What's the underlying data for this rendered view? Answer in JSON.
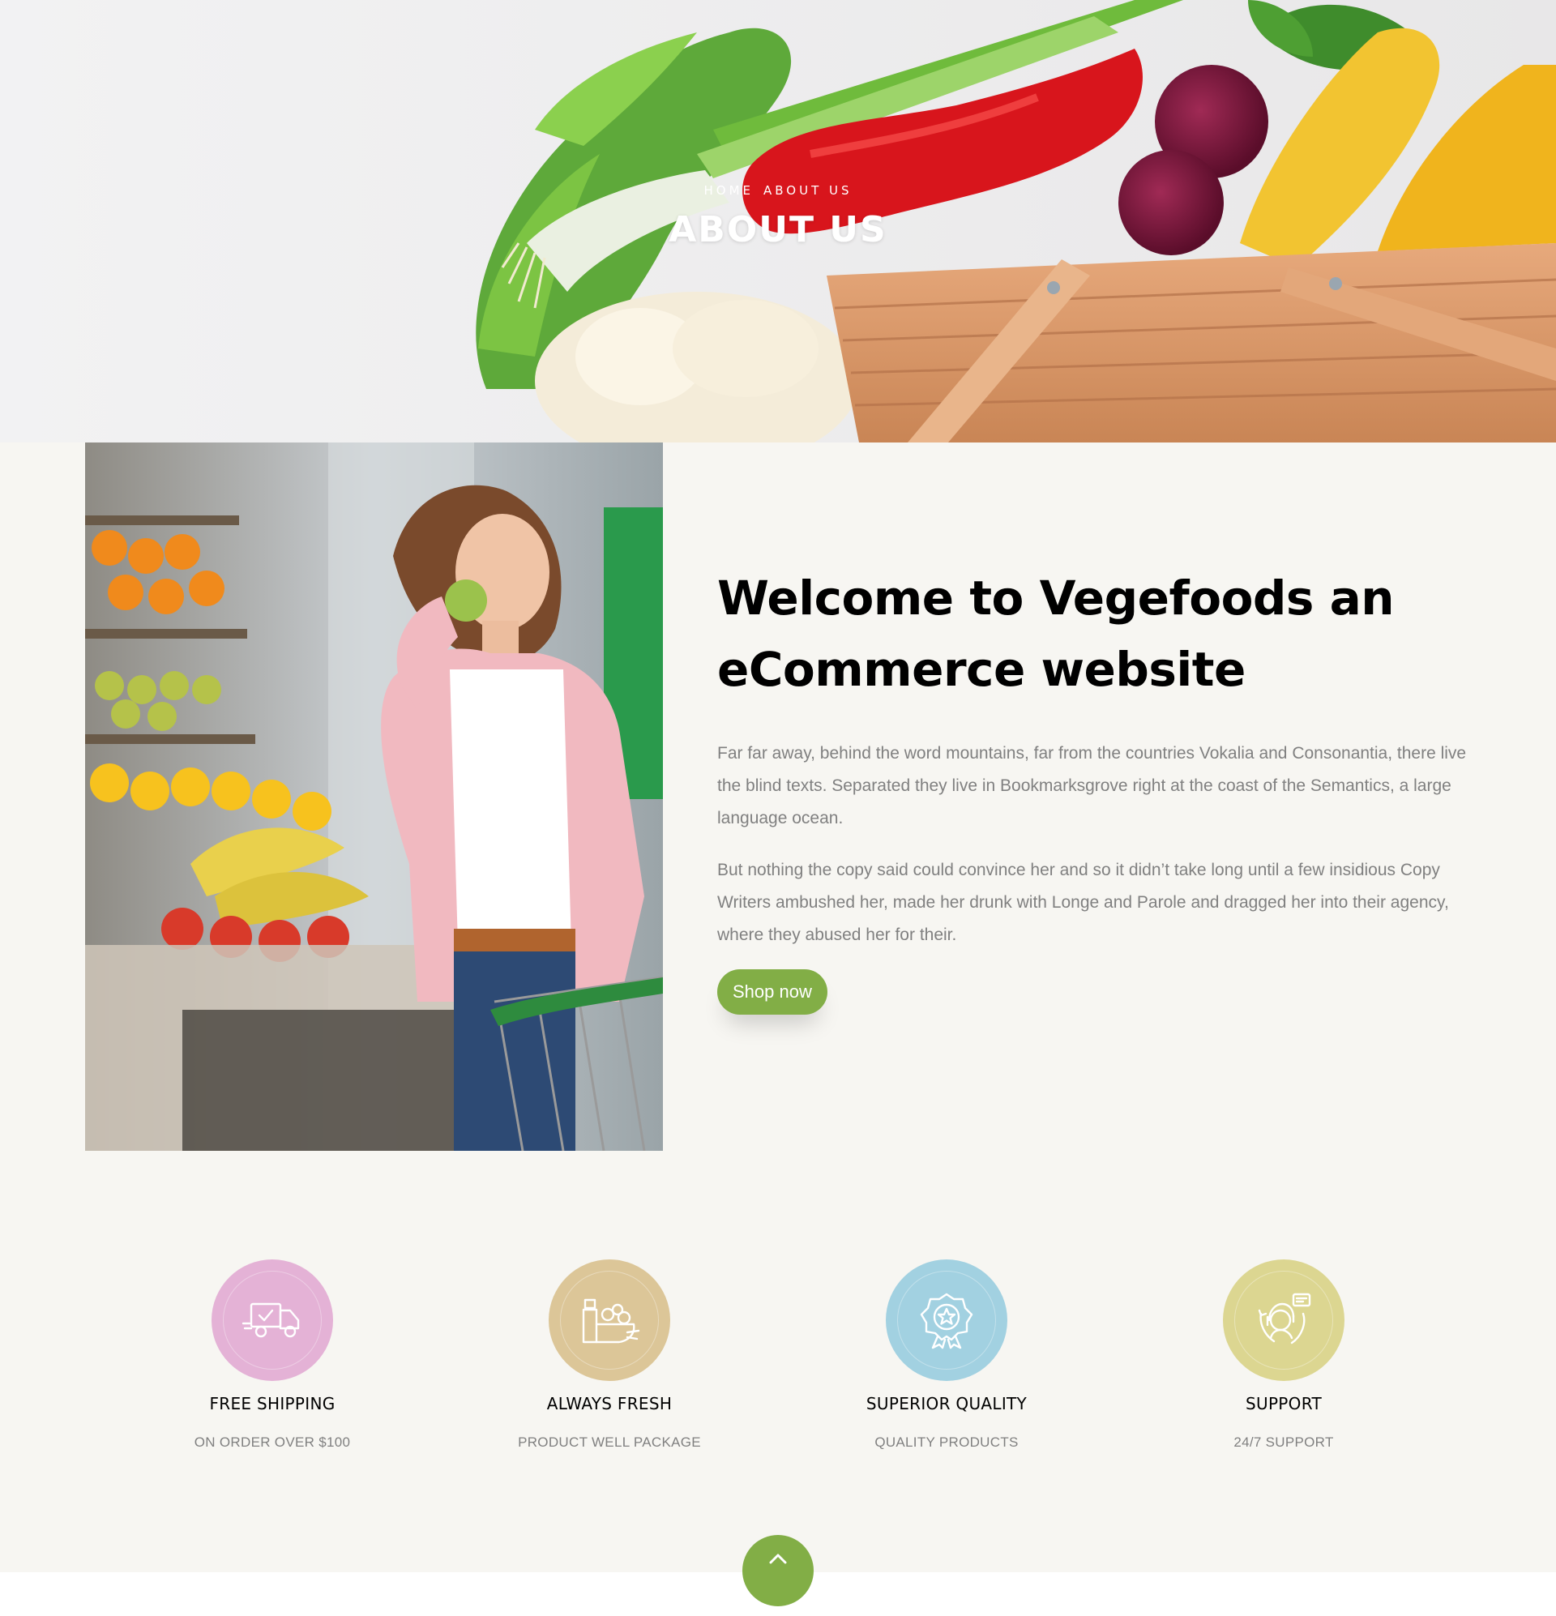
{
  "hero": {
    "breadcrumb": {
      "home": "Home",
      "current": "About us"
    },
    "title": "About us"
  },
  "about": {
    "heading_line1": "Welcome to Vegefoods an",
    "heading_line2": "eCommerce website",
    "paragraph1": "Far far away, behind the word mountains, far from the countries Vokalia and Consonantia, there live the blind texts. Separated they live in Bookmarksgrove right at the coast of the Semantics, a large language ocean.",
    "paragraph2": "But nothing the copy said could convince her and so it didn’t take long until a few insidious Copy Writers ambushed her, made her drunk with Longe and Parole and dragged her into their agency, where they abused her for their.",
    "button_label": "Shop now"
  },
  "features": [
    {
      "icon": "truck-icon",
      "color": "#e4b2d6",
      "title": "Free Shipping",
      "subtitle": "On order over $100"
    },
    {
      "icon": "fresh-basket-icon",
      "color": "#dcc698",
      "title": "Always Fresh",
      "subtitle": "Product well package"
    },
    {
      "icon": "quality-badge-icon",
      "color": "#a2d1e1",
      "title": "Superior Quality",
      "subtitle": "Quality Products"
    },
    {
      "icon": "support-agent-icon",
      "color": "#dcd691",
      "title": "Support",
      "subtitle": "24/7 Support"
    }
  ],
  "colors": {
    "accent": "#82ae46",
    "background": "#f7f6f2"
  },
  "back_to_top_icon": "chevron-up-icon"
}
